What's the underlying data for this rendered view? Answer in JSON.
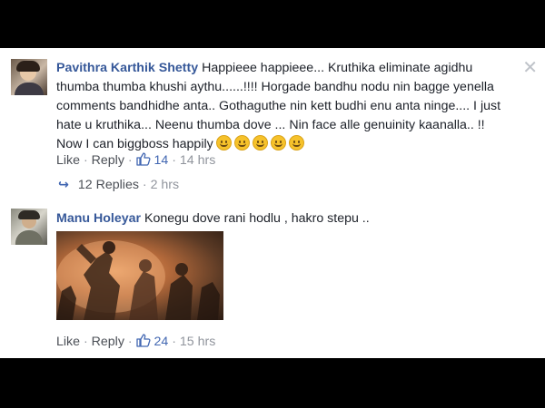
{
  "comments": [
    {
      "author": "Pavithra Karthik Shetty",
      "text": "Happieee happieee... Kruthika eliminate agidhu thumba thumba khushi aythu......!!!! Horgade bandhu nodu nin bagge yenella comments bandhidhe anta.. Gothaguthe nin kett budhi enu anta ninge.... I just hate u kruthika... Neenu thumba dove ... Nin face alle genuinity kaanalla.. !! Now I can biggboss happily",
      "emoji_count": 5,
      "like_label": "Like",
      "reply_label": "Reply",
      "likes": "14",
      "time": "14 hrs",
      "replies_label": "12 Replies",
      "replies_time": "2 hrs"
    },
    {
      "author": "Manu Holeyar",
      "text": "Konegu dove rani hodlu , hakro stepu ..",
      "like_label": "Like",
      "reply_label": "Reply",
      "likes": "24",
      "time": "15 hrs"
    }
  ],
  "icons": {
    "close": "close-icon",
    "like": "thumbs-up-icon",
    "reply_arrow": "reply-arrow-icon",
    "emoji": "smiley-emoji-icon"
  },
  "colors": {
    "name": "#365899",
    "likes": "#4267b2",
    "meta": "#90949c",
    "text": "#1d2129"
  }
}
